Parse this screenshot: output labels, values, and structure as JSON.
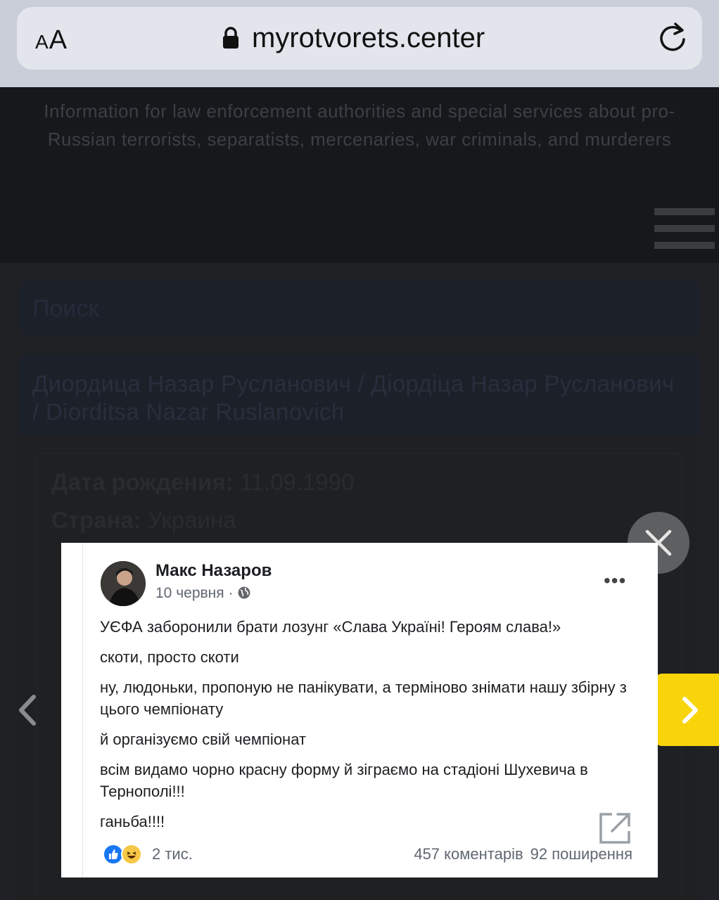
{
  "browser": {
    "text_size_label_small": "A",
    "text_size_label_large": "A",
    "url": "myrotvorets.center"
  },
  "site": {
    "tagline": "Information for law enforcement authorities and special services about pro-Russian terrorists, separatists, mercenaries, war criminals, and murderers",
    "search_label": "Поиск",
    "profile_title": "Диордица Назар Русланович / Діордіца Назар Русланович / Diorditsa Nazar Ruslanovich",
    "birth_label": "Дата рождения:",
    "birth_value": "11.09.1990",
    "country_label": "Страна:",
    "country_value": "Украина"
  },
  "post": {
    "author": "Макс Назаров",
    "date": "10 червня",
    "separator": " · ",
    "paragraphs": [
      "УЄФА заборонили брати лозунг «Слава Україні! Героям слава!»",
      "скоти, просто скоти",
      "ну, людоньки, пропоную не панікувати, а терміново знімати нашу збірну з цього чемпіонату",
      "й організуємо свій чемпіонат",
      "всім видамо чорно красну форму й зіграємо на стадіоні Шухевича в Тернополі!!!",
      "ганьба!!!!"
    ],
    "reaction_count": "2 тис.",
    "comments": "457 коментарів",
    "shares": "92 поширення",
    "more_glyph": "•••"
  },
  "colors": {
    "accent_next": "#f8d40a",
    "facebook_blue": "#1877f2"
  }
}
